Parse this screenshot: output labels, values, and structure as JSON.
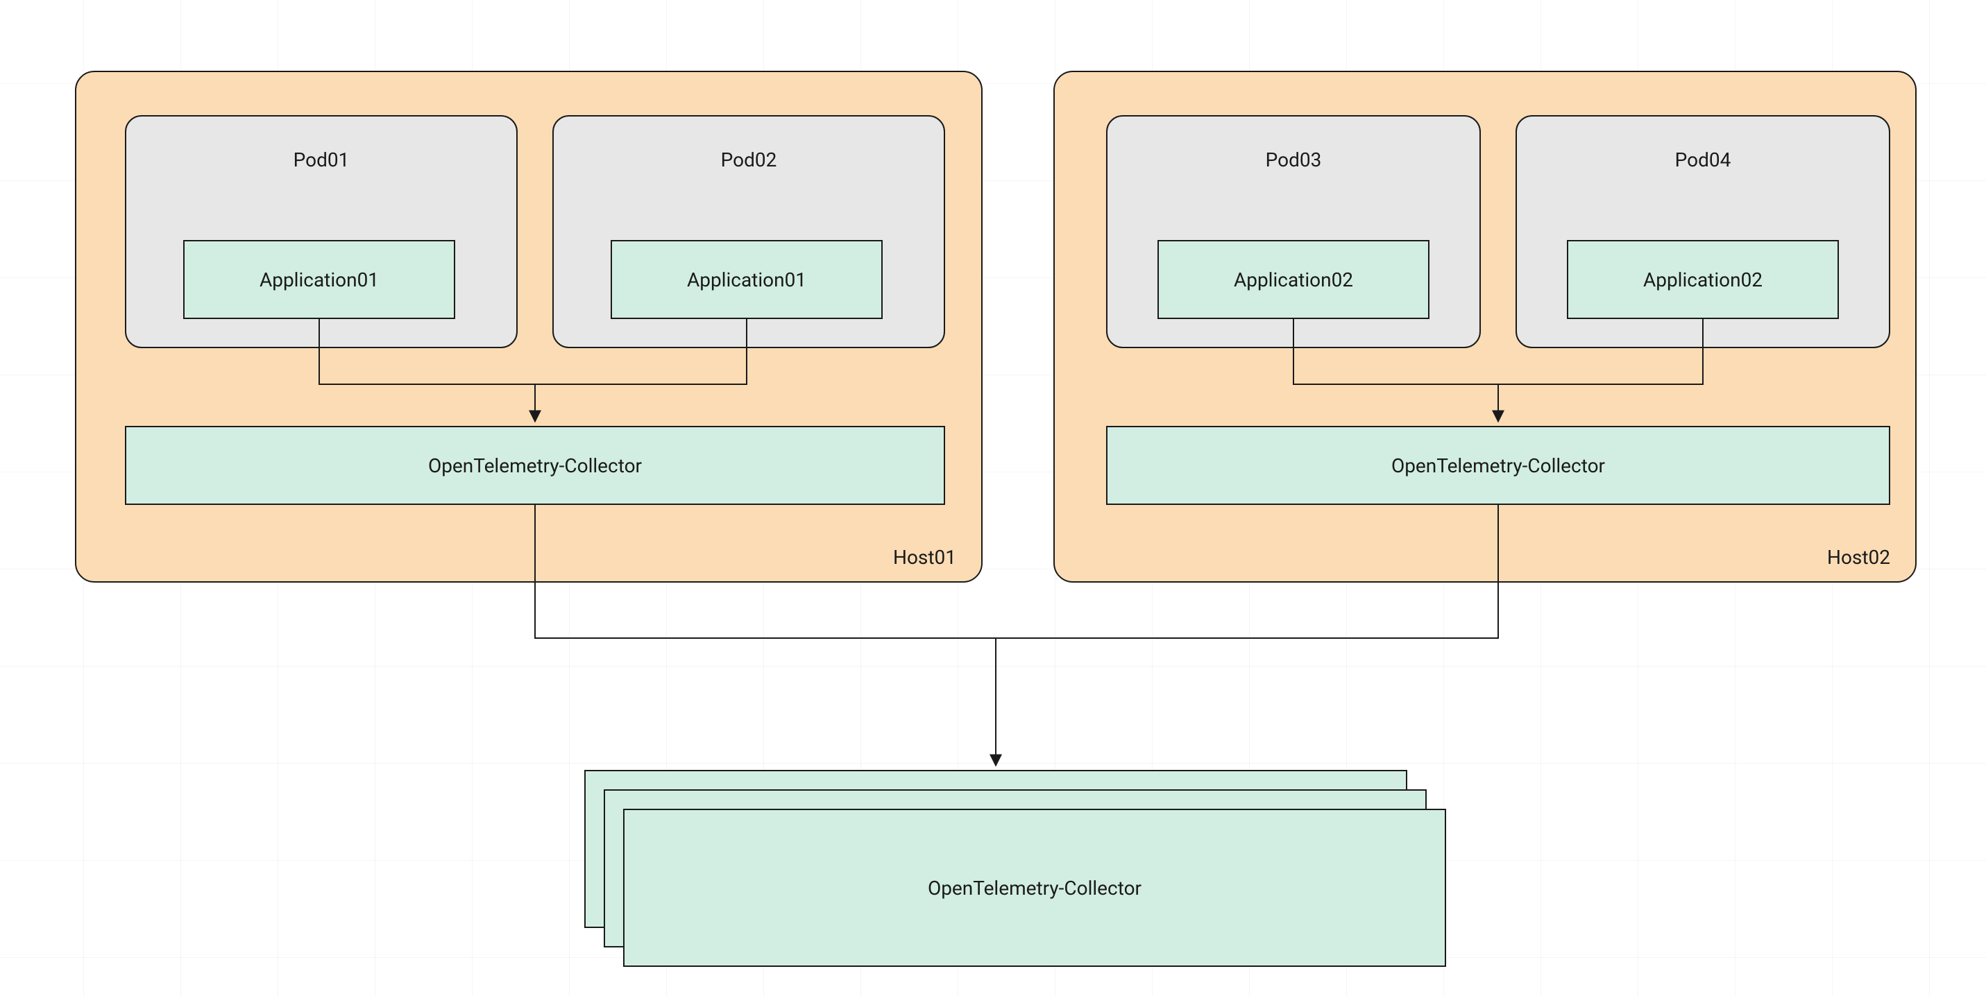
{
  "hosts": [
    {
      "name": "Host01",
      "collector": "OpenTelemetry-Collector",
      "pods": [
        {
          "name": "Pod01",
          "app": "Application01"
        },
        {
          "name": "Pod02",
          "app": "Application01"
        }
      ]
    },
    {
      "name": "Host02",
      "collector": "OpenTelemetry-Collector",
      "pods": [
        {
          "name": "Pod03",
          "app": "Application02"
        },
        {
          "name": "Pod04",
          "app": "Application02"
        }
      ]
    }
  ],
  "central_collector": "OpenTelemetry-Collector"
}
